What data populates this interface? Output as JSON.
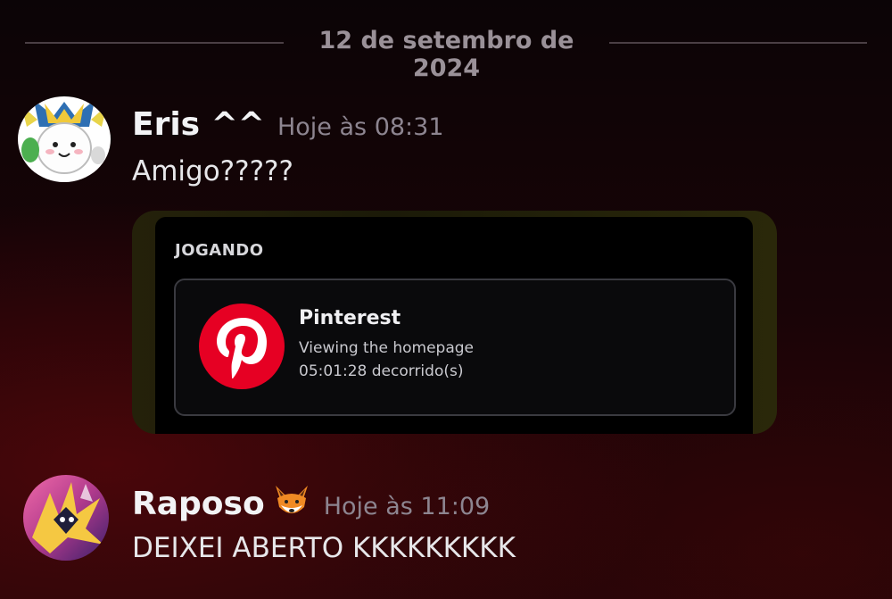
{
  "divider": {
    "date": "12 de setembro de 2024"
  },
  "messages": [
    {
      "author": "Eris ^^",
      "timestamp": "Hoje às 08:31",
      "text": "Amigo?????",
      "avatar_icon": "cat-avatar-icon",
      "activity": {
        "heading": "JOGANDO",
        "game_name": "Pinterest",
        "state": "Viewing the homepage",
        "elapsed": "05:01:28 decorrido(s)",
        "icon": "pinterest-icon",
        "icon_color": "#e60023"
      }
    },
    {
      "author": "Raposo",
      "author_emoji": "fox-emoji",
      "timestamp": "Hoje às 11:09",
      "text": "DEIXEI ABERTO KKKKKKKKK",
      "avatar_icon": "jolteon-avatar-icon"
    }
  ],
  "colors": {
    "background_top": "#0b0406",
    "background_bottom": "#220508",
    "card_accent": "#2a280a",
    "timestamp": "#8d8590"
  }
}
